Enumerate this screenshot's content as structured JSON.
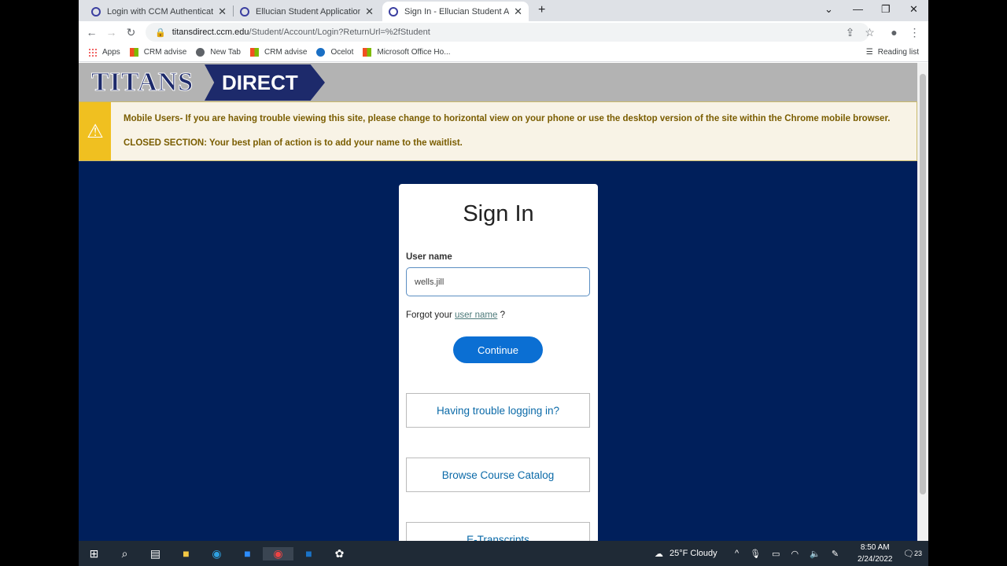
{
  "browser": {
    "tabs": [
      {
        "label": "Login with CCM Authentication",
        "active": false
      },
      {
        "label": "Ellucian Student Application",
        "active": false
      },
      {
        "label": "Sign In - Ellucian Student Application",
        "active": true
      }
    ],
    "url_host": "titansdirect.ccm.edu",
    "url_path": "/Student/Account/Login?ReturnUrl=%2fStudent",
    "bookmarks": [
      "Apps",
      "CRM advise",
      "New Tab",
      "CRM advise",
      "Ocelot",
      "Microsoft Office Ho..."
    ],
    "reading_list": "Reading list"
  },
  "site": {
    "logo_left": "TITANS",
    "logo_right": "DIRECT",
    "alert_line1": "Mobile Users- If you are having trouble viewing this site, please change to horizontal view on your phone or use the desktop version of the site within the Chrome mobile browser.",
    "alert_line2": "CLOSED SECTION: Your best plan of action is to add your name to the waitlist.",
    "accent": "#0b6fd3",
    "background": "#001f5b"
  },
  "signin": {
    "title": "Sign In",
    "username_label": "User name",
    "username_value": "wells.jill",
    "forgot_prefix": "Forgot your",
    "forgot_link": "user name",
    "forgot_suffix": "?",
    "continue": "Continue",
    "links": [
      "Having trouble logging in?",
      "Browse Course Catalog",
      "E-Transcripts"
    ]
  },
  "taskbar": {
    "weather": "25°F  Cloudy",
    "time": "8:50 AM",
    "date": "2/24/2022",
    "notifications": "23"
  }
}
